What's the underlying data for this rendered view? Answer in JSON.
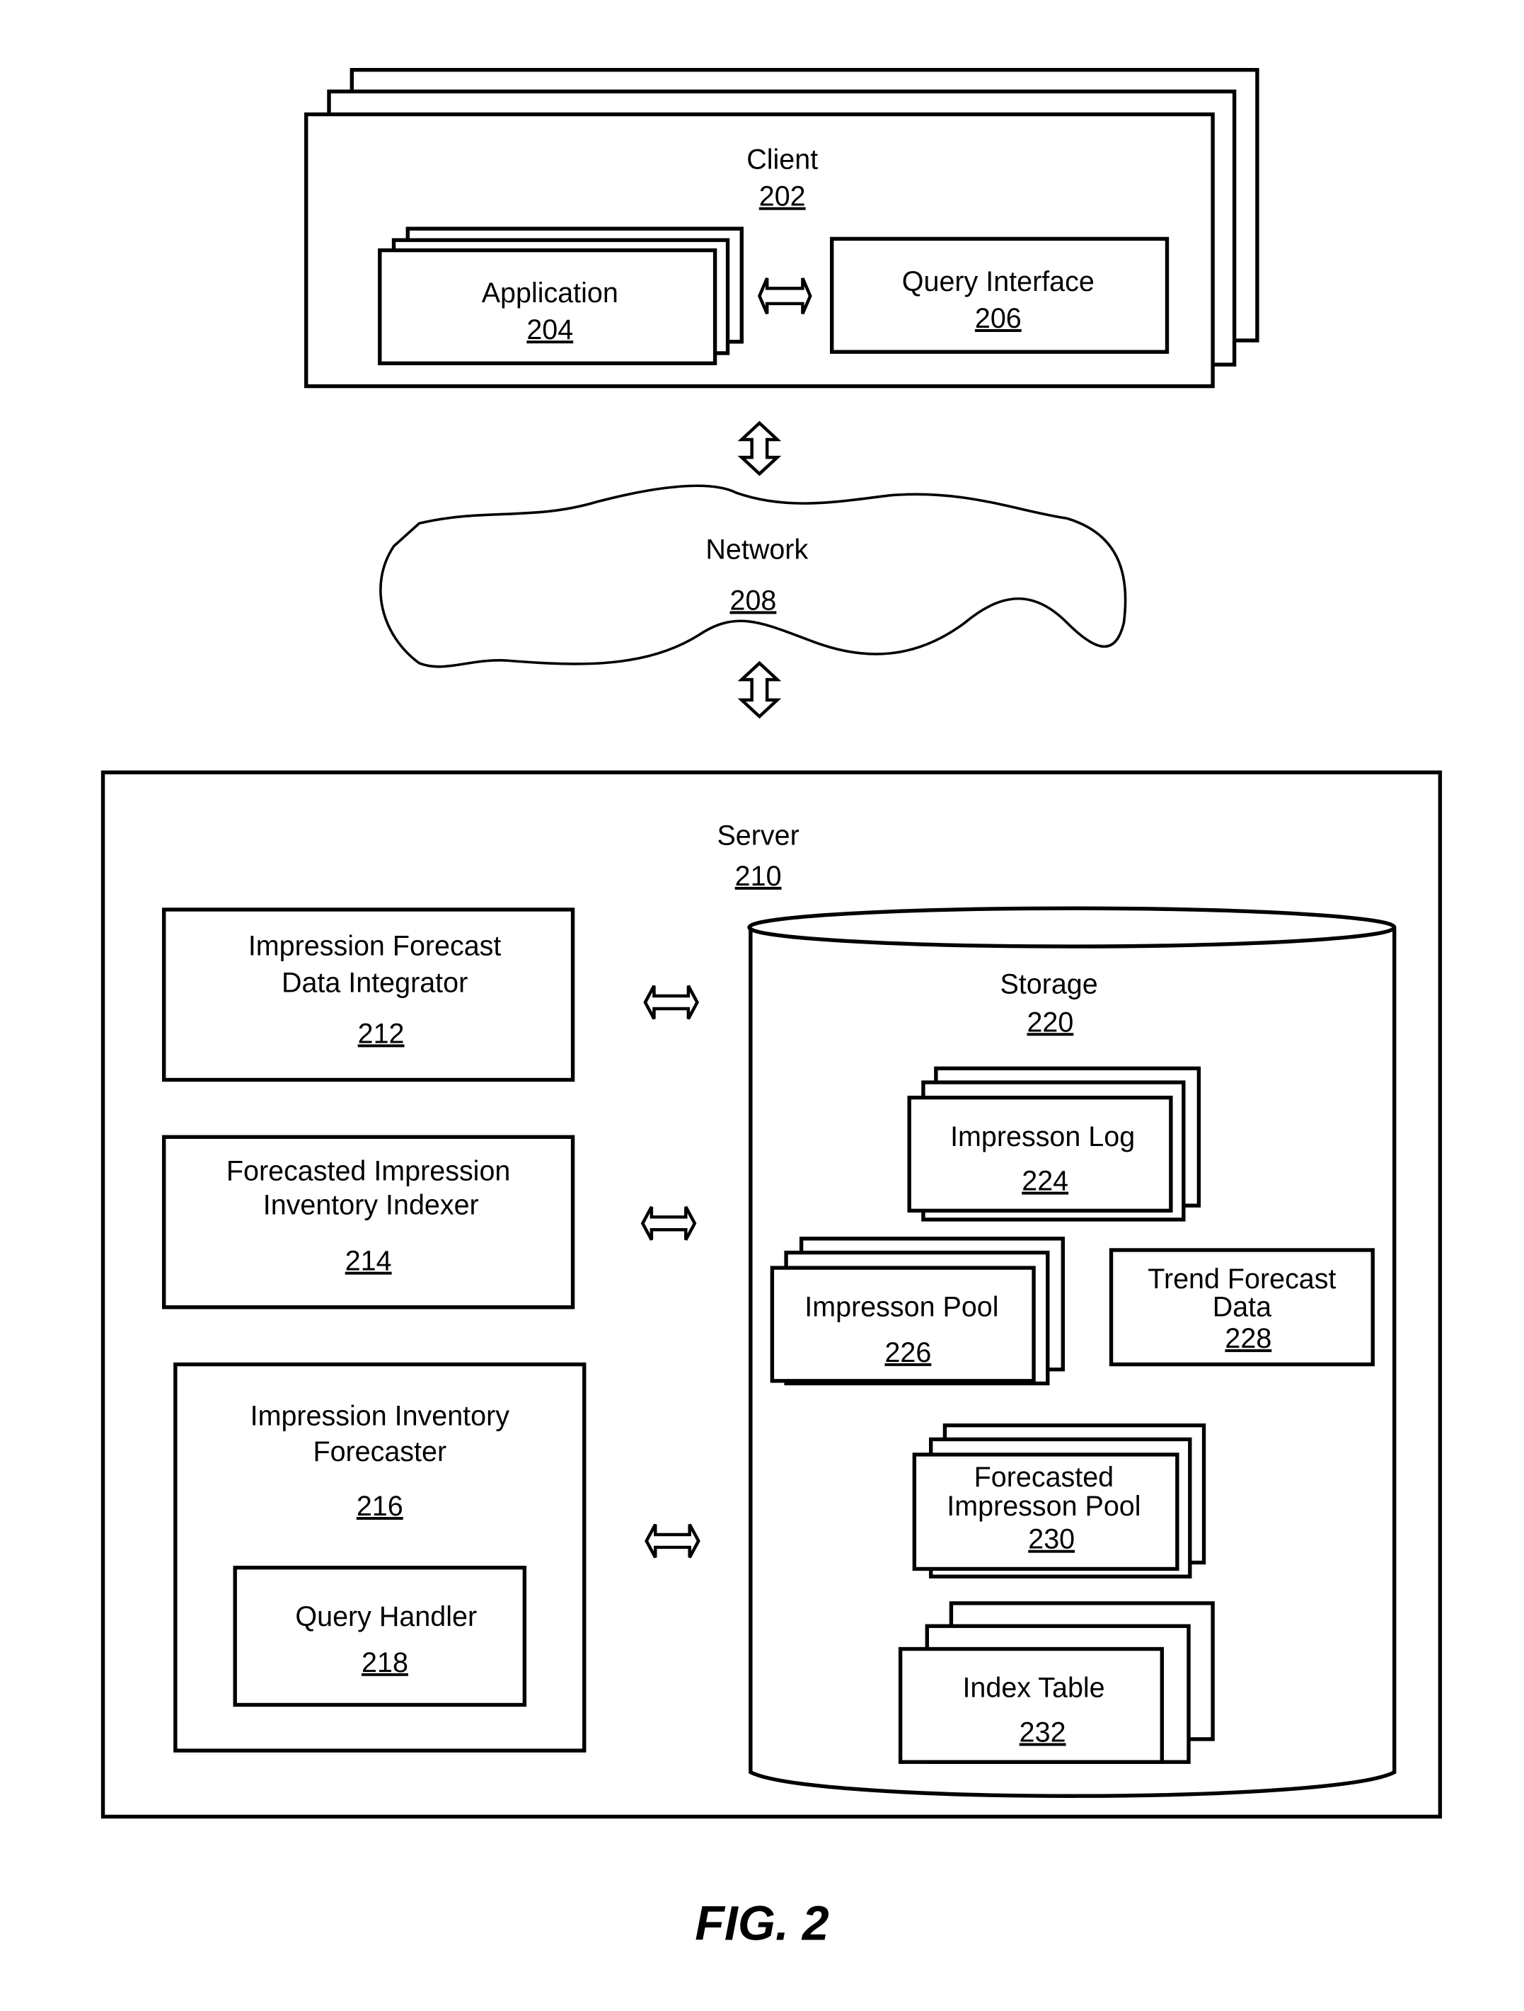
{
  "figure_label": "FIG. 2",
  "client": {
    "label": "Client",
    "ref": "202"
  },
  "application": {
    "label": "Application",
    "ref": "204"
  },
  "query_interface": {
    "label": "Query Interface",
    "ref": "206"
  },
  "network": {
    "label": "Network",
    "ref": "208"
  },
  "server": {
    "label": "Server",
    "ref": "210"
  },
  "data_integrator": {
    "lines": [
      "Impression Forecast",
      "Data Integrator"
    ],
    "ref": "212"
  },
  "indexer": {
    "lines": [
      "Forecasted Impression",
      "Inventory Indexer"
    ],
    "ref": "214"
  },
  "forecaster": {
    "lines": [
      "Impression Inventory",
      "Forecaster"
    ],
    "ref": "216"
  },
  "query_handler": {
    "label": "Query Handler",
    "ref": "218"
  },
  "storage": {
    "label": "Storage",
    "ref": "220"
  },
  "impression_log": {
    "label": "Impresson Log",
    "ref": "224"
  },
  "impression_pool": {
    "label": "Impresson Pool",
    "ref": "226"
  },
  "trend_forecast": {
    "lines": [
      "Trend Forecast",
      "Data"
    ],
    "ref": "228"
  },
  "forecasted_pool": {
    "lines": [
      "Forecasted",
      "Impresson Pool"
    ],
    "ref": "230"
  },
  "index_table": {
    "label": "Index Table",
    "ref": "232"
  }
}
